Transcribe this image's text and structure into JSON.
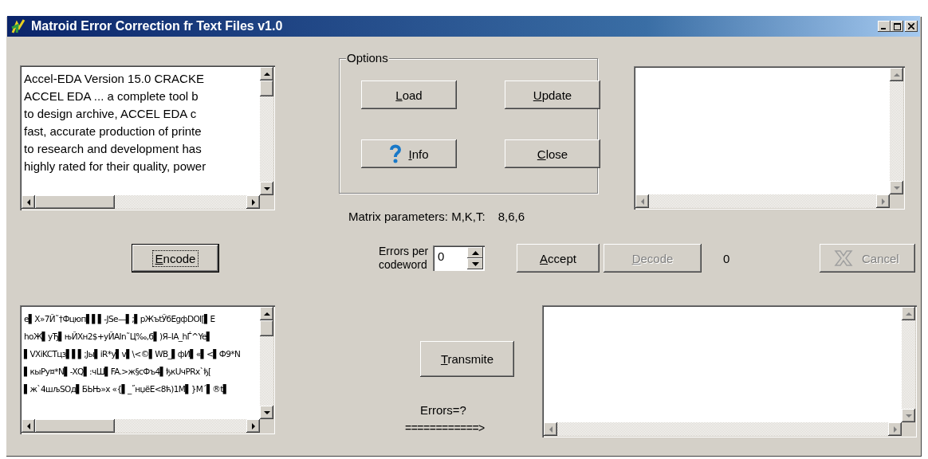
{
  "window": {
    "title": "Matroid Error Correction fr Text Files v1.0"
  },
  "source_text": {
    "scroll_enabled": true,
    "lines": [
      "Accel-EDA Version 15.0 CRACKE",
      "ACCEL EDA ... a complete tool b",
      "to design archive, ACCEL EDA c",
      "fast, accurate production of printe",
      "to research and development has",
      "highly rated for their quality, power"
    ]
  },
  "options": {
    "label": "Options",
    "buttons": [
      {
        "label": "Load",
        "accel": true,
        "kind": "plain"
      },
      {
        "label": "Update",
        "accel": true,
        "kind": "plain"
      },
      {
        "label": "Info",
        "accel": true,
        "kind": "help"
      },
      {
        "label": "Close",
        "accel": true,
        "kind": "plain"
      }
    ]
  },
  "matrix_parameters": {
    "label": "Matrix parameters: M,K,T:",
    "value": "8,6,6"
  },
  "decoded_text": {
    "scroll_enabled": false
  },
  "encode_button": {
    "label": "Encode",
    "accel": true,
    "focused": true,
    "disabled": false
  },
  "errors_per_codeword": {
    "label": "Errors per codeword",
    "value": "0"
  },
  "accept_button": {
    "label": "Accept",
    "accel": true,
    "focused": false,
    "disabled": false
  },
  "decode_button": {
    "label": "Decode",
    "accel": true,
    "focused": false,
    "disabled": true
  },
  "decode_count": "0",
  "cancel_button": {
    "label": "Cancel",
    "accel": false,
    "focused": false,
    "disabled": true
  },
  "encoded_text": {
    "scroll_enabled": true,
    "lines": [
      "e▌X»7Й˜†Фцюп▌▌▌-JSe—▌;▌pЖъtЎбEgфDOI[▌E",
      "hoЖ▌yЂ▌њЙXн2$+yЙAIn˜Ц‰,б▌)Я–IA_hЃ^Ye▌",
      "▌VXiKCTцз▌▌▌;Jы▌iR*y▌v▌\\<©▌WB_▌фИ▌«▌<▌Ф9*N",
      "▌кыPy¤*N▌-XQ▌:чШ▌FA.>ж§cФъ4▌ђкUчPRx`ђ[",
      "▌ж`4шљSOд▌БЬЊ»x «{▌_˝нџёE<8ћ)1M▌}M´▌®t▌"
    ]
  },
  "transmit_button": {
    "label": "Transmite",
    "accel": true,
    "focused": false,
    "disabled": false
  },
  "errors_label": "Errors=?",
  "arrow_label": "============>",
  "received_text": {
    "scroll_enabled": false
  }
}
